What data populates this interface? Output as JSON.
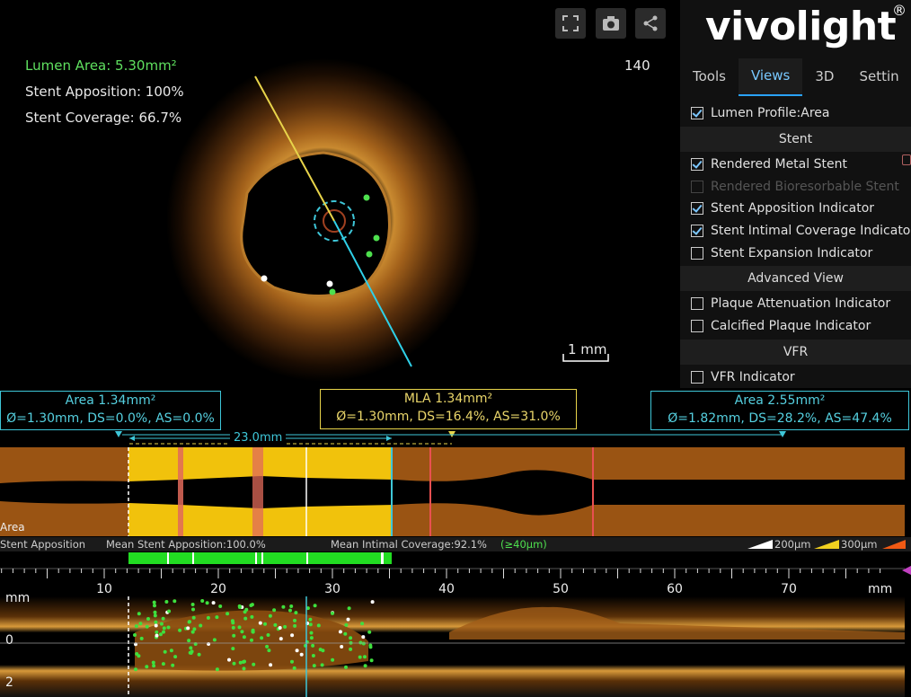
{
  "oct": {
    "frame_number": "140",
    "lumen_area": "Lumen Area: 5.30mm²",
    "stent_apposition": "Stent Apposition: 100%",
    "stent_coverage": "Stent Coverage: 66.7%",
    "scale_label": "1 mm",
    "colors": {
      "lumen_area": "#5fe05f",
      "guide_yellow": "#e8d44a",
      "guide_cyan": "#2fd0e8"
    }
  },
  "toolbar": {
    "fullscreen_icon": "fullscreen-icon",
    "camera_icon": "camera-icon",
    "share_icon": "share-icon"
  },
  "panel": {
    "logo": "vivolight",
    "logo_mark": "®",
    "tabs": [
      {
        "label": "Tools",
        "active": false
      },
      {
        "label": "Views",
        "active": true
      },
      {
        "label": "3D",
        "active": false
      },
      {
        "label": "Settin",
        "active": false
      }
    ],
    "lumen_profile": {
      "label": "Lumen Profile:Area",
      "checked": true
    },
    "stent_section": "Stent",
    "stent_options": [
      {
        "label": "Rendered Metal Stent",
        "checked": true,
        "disabled": false
      },
      {
        "label": "Rendered Bioresorbable Stent",
        "checked": false,
        "disabled": true
      },
      {
        "label": "Stent Apposition Indicator",
        "checked": true,
        "disabled": false
      },
      {
        "label": "Stent Intimal Coverage Indicator",
        "checked": true,
        "disabled": false
      },
      {
        "label": "Stent Expansion Indicator",
        "checked": false,
        "disabled": false
      }
    ],
    "advanced_section": "Advanced View",
    "advanced_options": [
      {
        "label": "Plaque Attenuation Indicator",
        "checked": false
      },
      {
        "label": "Calcified Plaque Indicator",
        "checked": false
      }
    ],
    "vfr_section": "VFR",
    "vfr_option": {
      "label": "VFR Indicator",
      "checked": false
    }
  },
  "measure": {
    "left": {
      "title": "Area 1.34mm²",
      "detail": "Ø=1.30mm, DS=0.0%, AS=0.0%"
    },
    "mla": {
      "title": "MLA 1.34mm²",
      "detail": "Ø=1.30mm, DS=16.4%, AS=31.0%"
    },
    "right": {
      "title": "Area 2.55mm²",
      "detail": "Ø=1.82mm, DS=28.2%, AS=47.4%"
    },
    "length": "23.0mm"
  },
  "profile": {
    "label": "Area"
  },
  "statusbar": {
    "left": "Stent Apposition",
    "mean_apposition": "Mean Stent Apposition:100.0%",
    "mean_coverage": "Mean Intimal Coverage:92.1%",
    "coverage_threshold": "(≥40μm)",
    "legend_200": "200μm",
    "legend_300": "300μm"
  },
  "ruler": {
    "unit": "mm",
    "ticks": [
      "10",
      "20",
      "30",
      "40",
      "50",
      "60",
      "70"
    ]
  },
  "longview": {
    "unit": "mm",
    "y_labels": [
      "0",
      "2"
    ]
  }
}
